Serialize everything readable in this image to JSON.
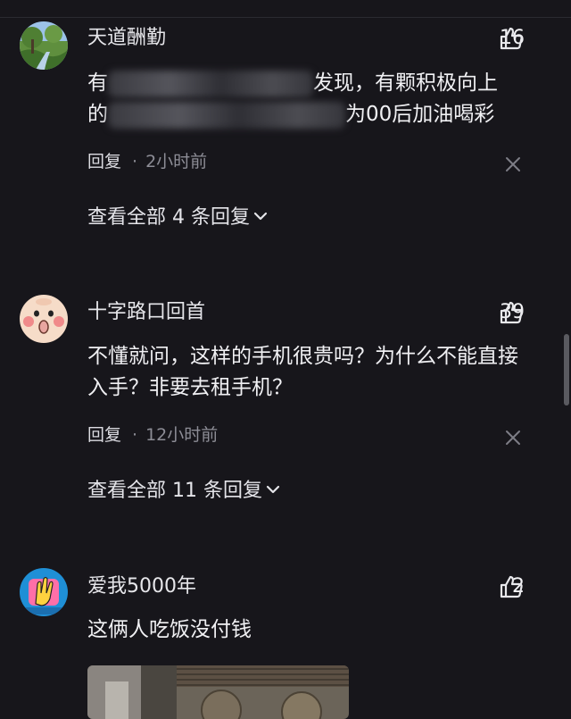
{
  "colors": {
    "background": "#17161b",
    "text_primary": "#f0f0f3",
    "text_secondary": "#8d8d96"
  },
  "comments": [
    {
      "username": "天道酬勤",
      "likes": "16",
      "text_start_1": "有",
      "text_end_1": "发现，有颗积极向上",
      "text_start_2": "的",
      "text_end_2": "为00后加油喝彩",
      "reply_label": "回复",
      "separator": "·",
      "time": "2小时前",
      "view_all": "查看全部 4 条回复",
      "avatar_icon": "landscape-avatar"
    },
    {
      "username": "十字路口回首",
      "likes": "39",
      "text": "不懂就问，这样的手机很贵吗？为什么不能直接入手？非要去租手机？",
      "reply_label": "回复",
      "separator": "·",
      "time": "12小时前",
      "view_all": "查看全部 11 条回复",
      "avatar_icon": "cartoon-face-avatar"
    },
    {
      "username": "爱我5000年",
      "likes": "2",
      "text": "这俩人吃饭没付钱",
      "avatar_icon": "hand-logo-avatar",
      "image_icon": "attached-photo"
    }
  ],
  "icons": {
    "like": "thumbs-up-icon",
    "close": "close-icon",
    "chevron": "chevron-down-icon"
  }
}
